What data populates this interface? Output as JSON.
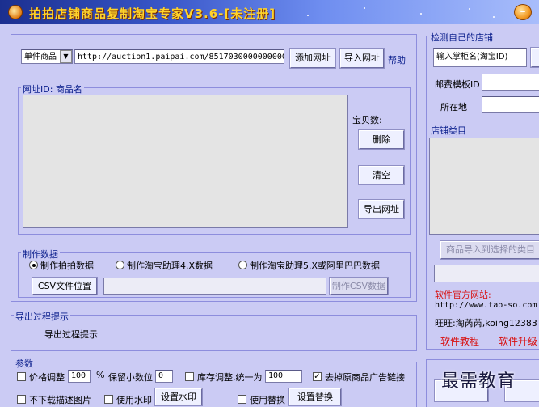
{
  "window": {
    "title": "拍拍店铺商品复制淘宝专家V3.6-[未注册]"
  },
  "top": {
    "type_select": "单件商品",
    "url_value": "http://auction1.paipai.com/85170300000000000401C",
    "add_url": "添加网址",
    "import_url": "导入网址",
    "help": "帮助"
  },
  "list_group": {
    "title": "网址ID: 商品名",
    "count_label": "宝贝数:",
    "delete": "删除",
    "clear": "清空",
    "export_url": "导出网址"
  },
  "make_group": {
    "title": "制作数据",
    "radios": [
      {
        "label": "制作拍拍数据",
        "checked": true
      },
      {
        "label": "制作淘宝助理4.X数据",
        "checked": false
      },
      {
        "label": "制作淘宝助理5.X或阿里巴巴数据",
        "checked": false
      }
    ],
    "csv_location": "CSV文件位置",
    "make_csv": "制作CSV数据"
  },
  "export_group": {
    "title": "导出过程提示",
    "text": "导出过程提示"
  },
  "params_group": {
    "title": "参数",
    "price_adjust": "价格调整",
    "price_value": "100",
    "percent": "%",
    "decimal_label": "保留小数位",
    "decimal_value": "0",
    "stock_label": "库存调整,统一为",
    "stock_value": "100",
    "remove_ads": "去掉原商品广告链接",
    "no_desc_img": "不下载描述图片",
    "use_watermark": "使用水印",
    "set_watermark": "设置水印",
    "use_replace": "使用替换",
    "set_replace": "设置替换"
  },
  "right": {
    "detect_title": "检测自己的店铺",
    "shop_input": "输入掌柜名(淘宝ID)",
    "shipping_label": "邮费模板ID",
    "location_label": "所在地",
    "category_title": "店铺类目",
    "import_category": "商品导入到选择的类目",
    "site_label": "软件官方网站:",
    "site_url": "http://www.tao-so.com",
    "wangwang": "旺旺:淘芮芮,koing12383",
    "tutorial": "软件教程",
    "upgrade": "软件升级"
  },
  "watermark_text": "最需教育",
  "colors": {
    "background": "#cbcbf4",
    "title_text": "#ffd42a",
    "link_red": "#d81010",
    "group_title": "#0a1e8c"
  }
}
